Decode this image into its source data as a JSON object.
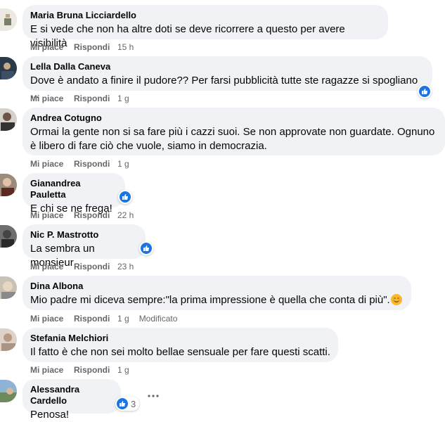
{
  "labels": {
    "like": "Mi piace",
    "reply": "Rispondi",
    "edited": "Modificato"
  },
  "comments": [
    {
      "author": "Maria Bruna Licciardello",
      "text": "E si vede che non ha altre doti se deve ricorrere a questo per avere visibilità",
      "time": "15 h"
    },
    {
      "author": "Lella Dalla Caneva",
      "text": "Dove è andato a finire il pudore?? Per farsi pubblicità tutte ste ragazze si spogliano ...",
      "time": "1 g"
    },
    {
      "author": "Andrea Cotugno",
      "text": "Ormai la gente non si sa fare più i cazzi suoi. Se non approvate non guardate. Ognuno è libero di fare ciò che vuole, siamo in democrazia.",
      "time": "1 g"
    },
    {
      "author": "Gianandrea Pauletta",
      "text": "E chi se ne frega!",
      "time": "22 h"
    },
    {
      "author": "Nic P. Mastrotto",
      "text": "La sembra un monsieur",
      "time": "23 h"
    },
    {
      "author": "Dina Albona",
      "text": "Mio padre mi diceva sempre:\"la prima impressione è quella che conta di più\".",
      "time": "1 g"
    },
    {
      "author": "Stefania Melchiori",
      "text": "Il fatto è che non sei molto bellae sensuale per fare questi scatti.",
      "time": "1 g"
    },
    {
      "author": "Alessandra Cardello",
      "text": "Penosa!",
      "reaction_count": "3"
    }
  ],
  "colors": {
    "bubble": "#f0f2f5",
    "meta": "#65676b",
    "like_blue": "#1b74e4"
  },
  "icons": {
    "reaction": "like-icon",
    "more": "more-options-icon",
    "emoji": "smiling-face-icon"
  }
}
